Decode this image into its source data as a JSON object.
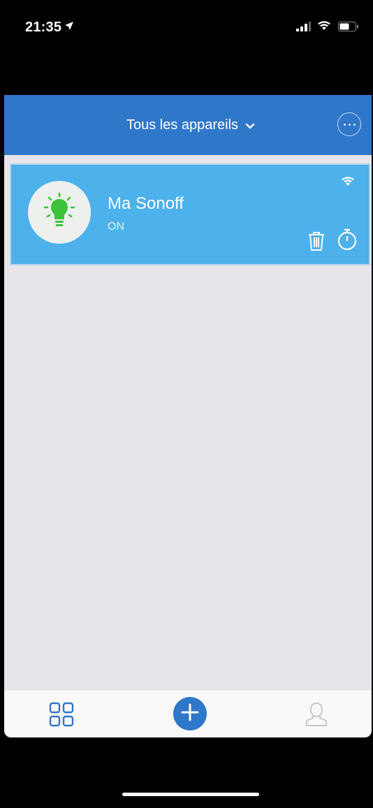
{
  "status_bar": {
    "time": "21:35",
    "icons": [
      "location-arrow-icon",
      "signal-icon",
      "wifi-icon",
      "battery-icon"
    ]
  },
  "header": {
    "title": "Tous les appareils",
    "dropdown_icon": "chevron-down-icon",
    "more_icon": "more-options-icon"
  },
  "devices": [
    {
      "name": "Ma Sonoff",
      "state": "ON",
      "icon": "lightbulb-icon",
      "icon_color": "#3bc43a",
      "actions": [
        "trash-icon",
        "timer-icon"
      ],
      "connectivity_icon": "wifi-icon"
    }
  ],
  "tab_bar": {
    "items": [
      "grid-icon",
      "add-icon",
      "profile-icon"
    ]
  },
  "colors": {
    "header": "#2f77c9",
    "card": "#4db1ec",
    "background": "#e6e6eb",
    "accent": "#2f77c9"
  }
}
